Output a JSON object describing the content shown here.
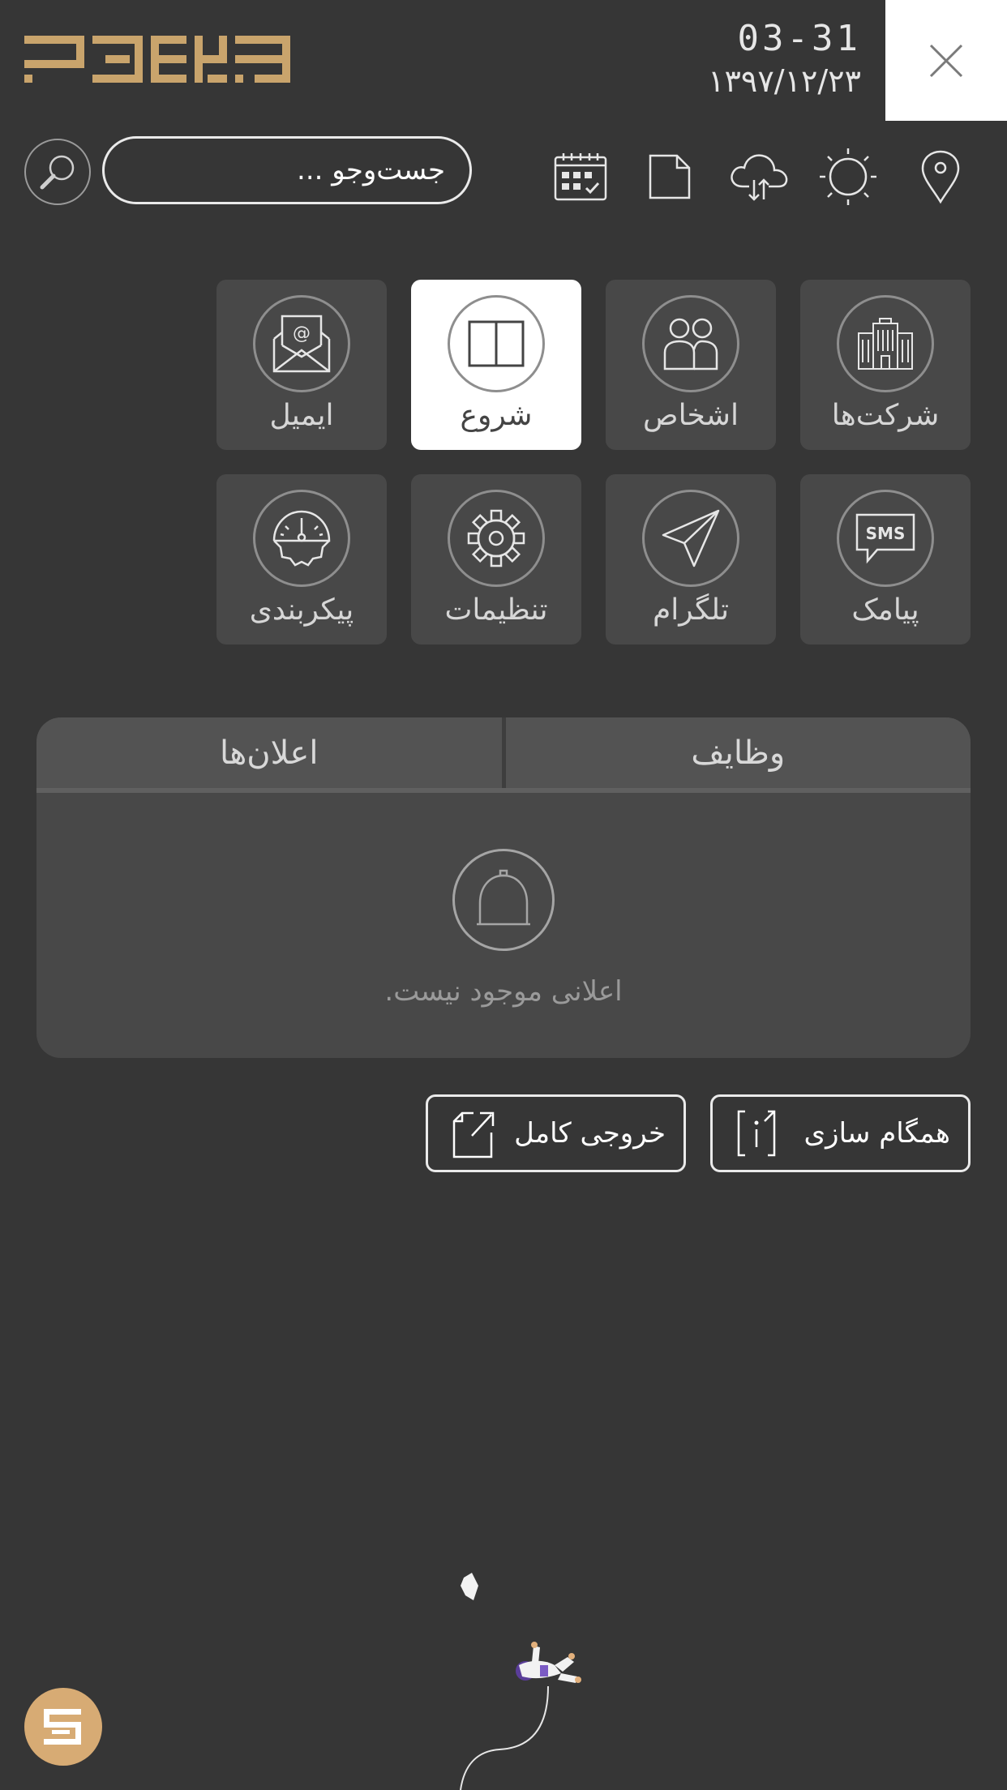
{
  "header": {
    "time": "03-31",
    "date": "۱۳۹۷/۱۲/۲۳",
    "logo_color": "#c9a46c"
  },
  "toolbar": {
    "search_placeholder": "جست‌وجو ...",
    "icons": [
      "search-icon",
      "calendar-icon",
      "document-icon",
      "cloud-sync-icon",
      "sun-icon",
      "location-pin-icon"
    ]
  },
  "tiles": [
    {
      "label": "شرکت‌ها",
      "icon": "buildings-icon"
    },
    {
      "label": "اشخاص",
      "icon": "people-icon"
    },
    {
      "label": "شروع",
      "icon": "panels-icon",
      "active": true
    },
    {
      "label": "ایمیل",
      "icon": "email-icon"
    },
    {
      "label": "پیامک",
      "icon": "sms-icon",
      "icon_text": "SMS"
    },
    {
      "label": "تلگرام",
      "icon": "telegram-icon"
    },
    {
      "label": "تنظیمات",
      "icon": "gear-icon"
    },
    {
      "label": "پیکربندی",
      "icon": "dashboard-icon"
    }
  ],
  "panel": {
    "tabs": [
      "وظایف",
      "اعلان‌ها"
    ],
    "empty_message": "اعلانی موجود نیست."
  },
  "actions": {
    "sync_label": "همگام سازی",
    "export_label": "خروجی کامل"
  },
  "colors": {
    "background": "#363636",
    "tile": "#484848",
    "accent": "#d7ab74"
  }
}
